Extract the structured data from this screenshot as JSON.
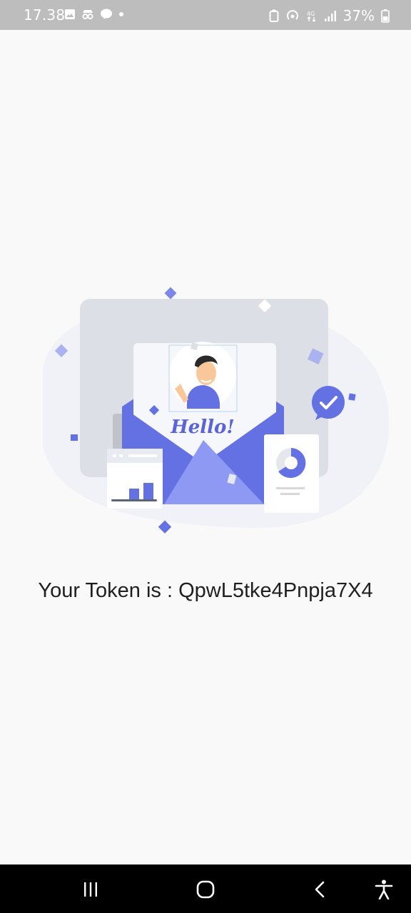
{
  "status_bar": {
    "time": "17.38",
    "battery": "37%",
    "icons_left": [
      "image-icon",
      "incognito-icon",
      "line-chat-icon",
      "dot-icon"
    ],
    "icons_right": [
      "battery-saver-icon",
      "hotspot-icon",
      "data-4g-icon",
      "signal-icon",
      "battery-icon"
    ]
  },
  "illustration": {
    "hello_text": "Hello!"
  },
  "token": {
    "label": "Your Token is : QpwL5tke4Pnpja7X4"
  },
  "nav_bar": {
    "items": [
      "recent-apps",
      "home",
      "back",
      "accessibility"
    ]
  },
  "colors": {
    "accent": "#6471e3",
    "accent_light": "#8e99f3",
    "background": "#f9f9fa"
  }
}
